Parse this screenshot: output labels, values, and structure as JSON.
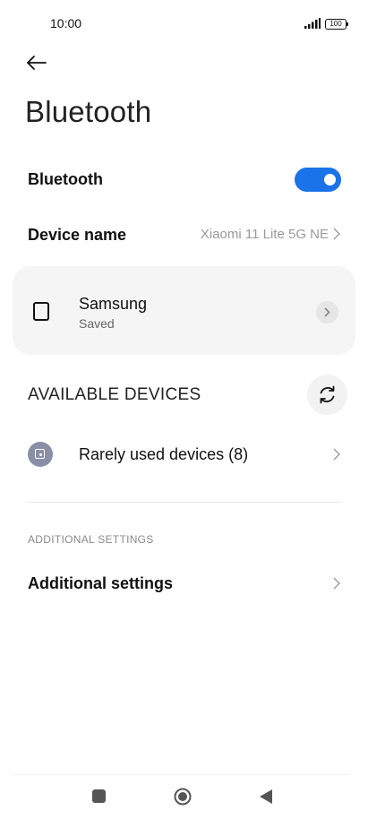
{
  "status_bar": {
    "time": "10:00",
    "battery": "100"
  },
  "header": {
    "title": "Bluetooth"
  },
  "bluetooth_toggle": {
    "label": "Bluetooth",
    "enabled": true,
    "color": "#1a73e8"
  },
  "device_name": {
    "label": "Device name",
    "value": "Xiaomi 11 Lite 5G NE"
  },
  "saved_device": {
    "name": "Samsung",
    "status": "Saved"
  },
  "available": {
    "heading": "AVAILABLE DEVICES",
    "rarely_used": "Rarely used devices (8)"
  },
  "additional": {
    "heading": "ADDITIONAL SETTINGS",
    "label": "Additional settings"
  },
  "icons": [
    "signal-icon",
    "battery-icon",
    "back-arrow-icon",
    "device-icon",
    "chevron-right-icon",
    "refresh-icon",
    "nav-recents-icon",
    "nav-home-icon",
    "nav-back-icon"
  ]
}
